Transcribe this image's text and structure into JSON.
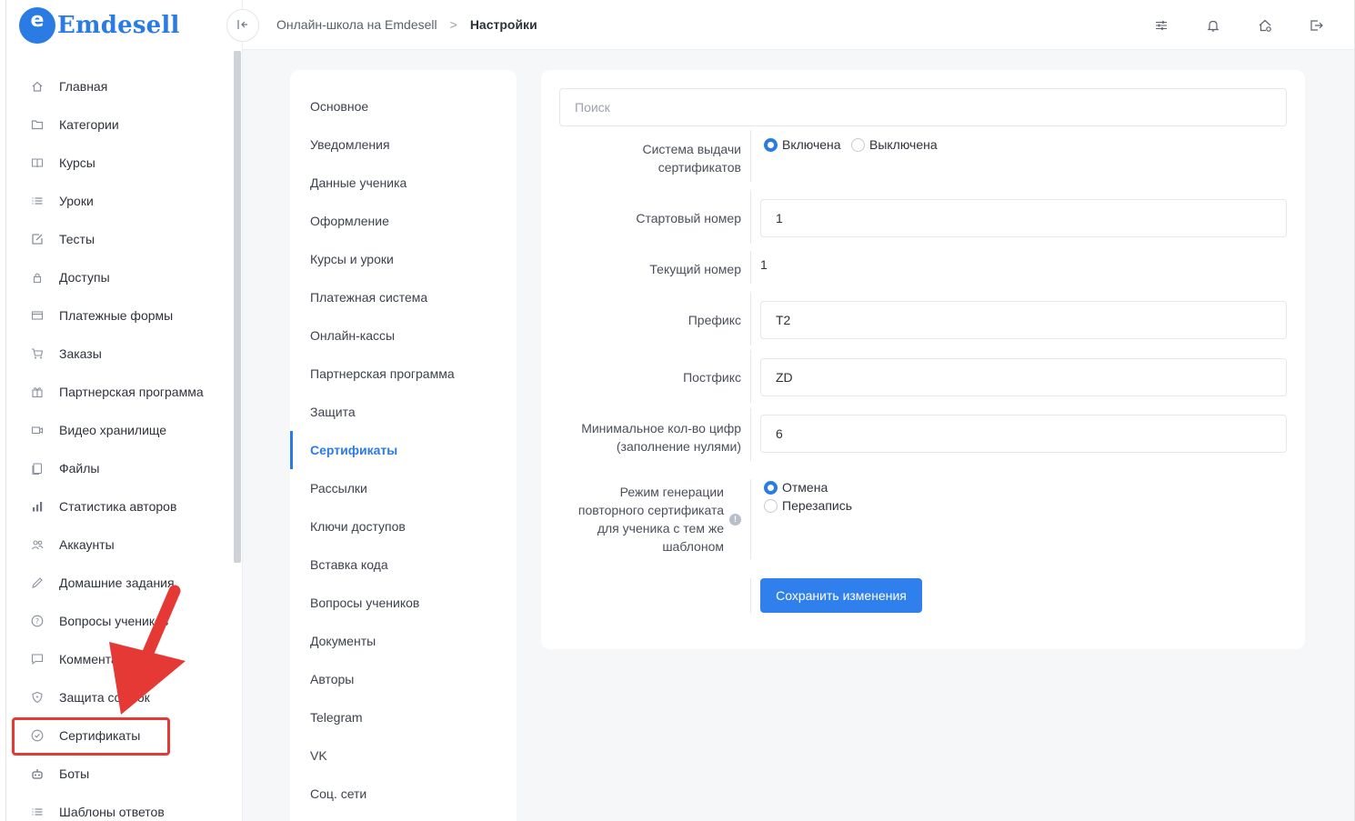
{
  "brand": {
    "logo_letter": "e",
    "name": "Emdesell"
  },
  "sidebar": {
    "items": [
      {
        "label": "Главная",
        "icon": "home-icon"
      },
      {
        "label": "Категории",
        "icon": "folder-icon"
      },
      {
        "label": "Курсы",
        "icon": "book-icon"
      },
      {
        "label": "Уроки",
        "icon": "list-icon"
      },
      {
        "label": "Тесты",
        "icon": "edit-icon"
      },
      {
        "label": "Доступы",
        "icon": "lock-icon"
      },
      {
        "label": "Платежные формы",
        "icon": "credit-card-icon"
      },
      {
        "label": "Заказы",
        "icon": "cart-icon"
      },
      {
        "label": "Партнерская программа",
        "icon": "gift-icon"
      },
      {
        "label": "Видео хранилище",
        "icon": "video-icon"
      },
      {
        "label": "Файлы",
        "icon": "file-icon"
      },
      {
        "label": "Статистика авторов",
        "icon": "bar-chart-icon"
      },
      {
        "label": "Аккаунты",
        "icon": "users-icon"
      },
      {
        "label": "Домашние задания",
        "icon": "pencil-icon"
      },
      {
        "label": "Вопросы учеников",
        "icon": "question-icon"
      },
      {
        "label": "Комментарии",
        "icon": "comment-icon"
      },
      {
        "label": "Защита ссылок",
        "icon": "shield-icon"
      },
      {
        "label": "Сертификаты",
        "icon": "certificate-icon"
      },
      {
        "label": "Боты",
        "icon": "robot-icon"
      },
      {
        "label": "Шаблоны ответов",
        "icon": "list-icon"
      }
    ]
  },
  "topbar": {
    "collapse_icon": "collapse-left-icon",
    "breadcrumb": {
      "parent": "Онлайн-школа на Emdesell",
      "separator": ">",
      "current": "Настройки"
    },
    "icons": [
      "sliders-icon",
      "bell-icon",
      "home-settings-icon",
      "logout-icon"
    ]
  },
  "settings_menu": {
    "active": "Сертификаты",
    "items": [
      "Основное",
      "Уведомления",
      "Данные ученика",
      "Оформление",
      "Курсы и уроки",
      "Платежная система",
      "Онлайн-кассы",
      "Партнерская программа",
      "Защита",
      "Сертификаты",
      "Рассылки",
      "Ключи доступов",
      "Вставка кода",
      "Вопросы учеников",
      "Документы",
      "Авторы",
      "Telegram",
      "VK",
      "Соц. сети"
    ]
  },
  "form": {
    "search_placeholder": "Поиск",
    "system": {
      "label_line1": "Система выдачи",
      "label_line2": "сертификатов",
      "option_on": "Включена",
      "option_off": "Выключена",
      "selected": "Включена"
    },
    "start_number": {
      "label": "Стартовый номер",
      "value": "1"
    },
    "current_number": {
      "label": "Текущий номер",
      "value": "1"
    },
    "prefix": {
      "label": "Префикс",
      "value": "T2"
    },
    "postfix": {
      "label": "Постфикс",
      "value": "ZD"
    },
    "min_digits": {
      "label_line1": "Минимальное кол-во цифр",
      "label_line2": "(заполнение нулями)",
      "value": "6"
    },
    "regen_mode": {
      "label_line1": "Режим генерации",
      "label_line2": "повторного сертификата",
      "label_line3": "для ученика с тем же",
      "label_line4": "шаблоном",
      "info_icon": "info-icon",
      "info_glyph": "!",
      "option_cancel": "Отмена",
      "option_overwrite": "Перезапись",
      "selected": "Отмена"
    },
    "save_label": "Сохранить изменения"
  },
  "colors": {
    "accent": "#2a7be4",
    "button": "#2f80ed",
    "annotation": "#e53935"
  }
}
